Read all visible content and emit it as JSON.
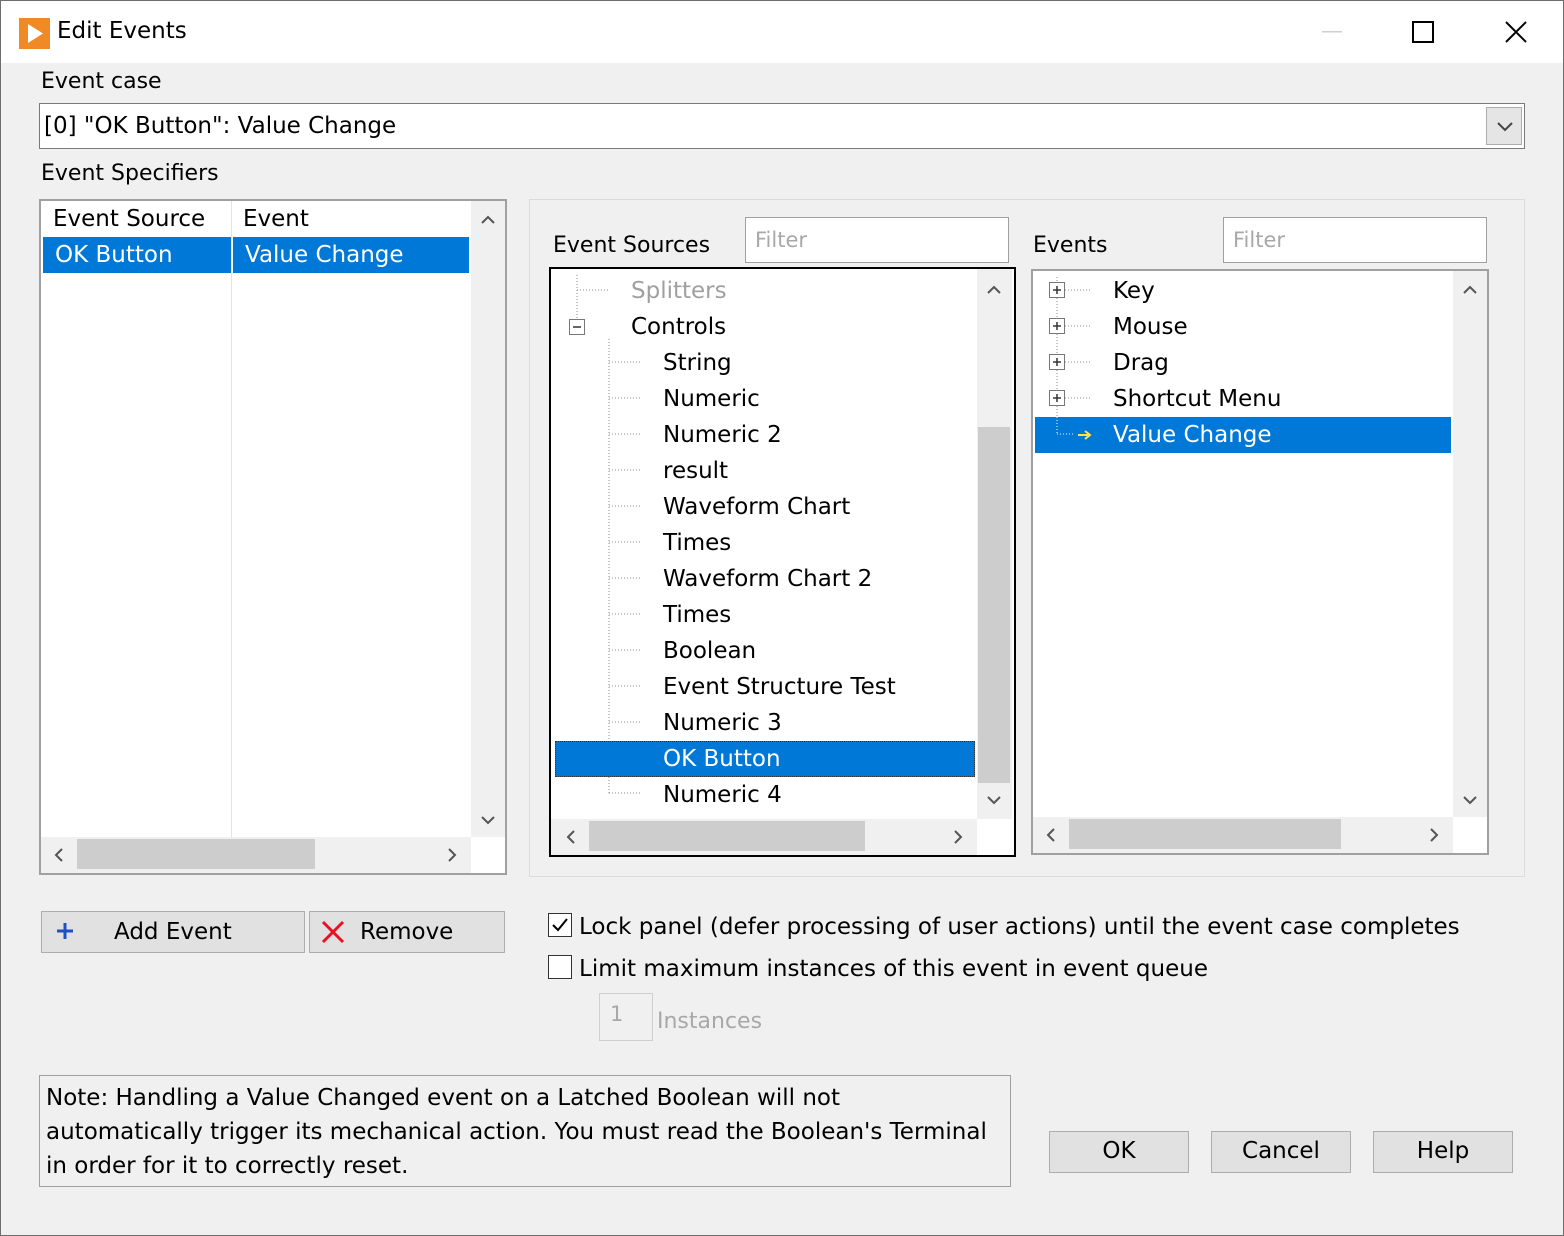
{
  "window": {
    "title": "Edit Events",
    "icon": "labview-run-icon"
  },
  "event_case": {
    "label": "Event case",
    "value": "[0] \"OK Button\": Value Change"
  },
  "specifiers": {
    "label": "Event Specifiers",
    "col_source": "Event Source",
    "col_event": "Event",
    "rows": [
      {
        "source": "OK Button",
        "event": "Value Change",
        "selected": true
      }
    ]
  },
  "sources": {
    "label": "Event Sources",
    "filter_placeholder": "Filter",
    "items": [
      {
        "label": "Splitters",
        "level": 0,
        "disabled": true
      },
      {
        "label": "Controls",
        "level": 0,
        "expander": "minus"
      },
      {
        "label": "String",
        "level": 1
      },
      {
        "label": "Numeric",
        "level": 1
      },
      {
        "label": "Numeric 2",
        "level": 1
      },
      {
        "label": "result",
        "level": 1
      },
      {
        "label": "Waveform Chart",
        "level": 1
      },
      {
        "label": "Times",
        "level": 1
      },
      {
        "label": "Waveform Chart 2",
        "level": 1
      },
      {
        "label": "Times",
        "level": 1
      },
      {
        "label": "Boolean",
        "level": 1
      },
      {
        "label": "Event Structure Test",
        "level": 1
      },
      {
        "label": "Numeric 3",
        "level": 1
      },
      {
        "label": "OK Button",
        "level": 1,
        "selected": true
      },
      {
        "label": "Numeric 4",
        "level": 1
      }
    ]
  },
  "events": {
    "label": "Events",
    "filter_placeholder": "Filter",
    "items": [
      {
        "label": "Key",
        "expander": "plus"
      },
      {
        "label": "Mouse",
        "expander": "plus"
      },
      {
        "label": "Drag",
        "expander": "plus"
      },
      {
        "label": "Shortcut Menu",
        "expander": "plus"
      },
      {
        "label": "Value Change",
        "selected": true,
        "marker": "arrow-icon"
      }
    ]
  },
  "buttons": {
    "add_event": "Add Event",
    "remove": "Remove",
    "ok": "OK",
    "cancel": "Cancel",
    "help": "Help"
  },
  "options": {
    "lock_panel": {
      "label": "Lock panel (defer processing of user actions) until the event case completes",
      "checked": true
    },
    "limit_instances": {
      "label": "Limit maximum instances of this event in event queue",
      "checked": false
    },
    "instances_value": "1",
    "instances_label": "Instances"
  },
  "note": {
    "lines": [
      "Note:  Handling a Value Changed event on a Latched Boolean will not",
      "automatically trigger its mechanical action. You must read the Boolean's Terminal",
      "in order for it to correctly reset."
    ]
  },
  "colors": {
    "selection": "#0078d7",
    "dialog_bg": "#f0f0f0",
    "add_icon": "#1e50c8",
    "remove_icon": "#e81123"
  }
}
